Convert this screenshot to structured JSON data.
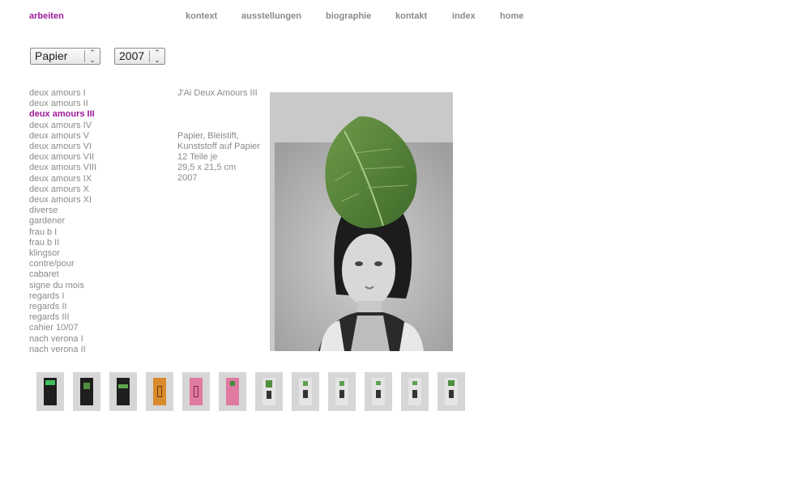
{
  "nav": {
    "arbeiten": "arbeiten",
    "kontext": "kontext",
    "ausstellungen": "ausstellungen",
    "biographie": "biographie",
    "kontakt": "kontakt",
    "index": "index",
    "home": "home"
  },
  "filters": {
    "material": "Papier",
    "year": "2007"
  },
  "works": [
    "deux amours I",
    "deux amours II",
    "deux amours III",
    "deux amours IV",
    "deux amours V",
    "deux amours VI",
    "deux amours VII",
    "deux amours VIII",
    "deux amours IX",
    "deux amours X",
    "deux amours XI",
    "diverse",
    "gardener",
    "frau b I",
    "frau b II",
    "klingsor",
    "contre/pour",
    "cabaret",
    "signe du mois",
    "regards I",
    "regards II",
    "regards III",
    "cahier 10/07",
    "nach verona I",
    "nach verona II"
  ],
  "work": {
    "title": "J'Ai Deux Amours III",
    "material": "Papier, Bleistift, Kunststoff auf Papier",
    "parts": "12 Teile je",
    "size": "29,5 x 21,5 cm",
    "year": "2007"
  },
  "colors": {
    "accent": "#9b1a9b",
    "text": "#8a8a8a"
  }
}
